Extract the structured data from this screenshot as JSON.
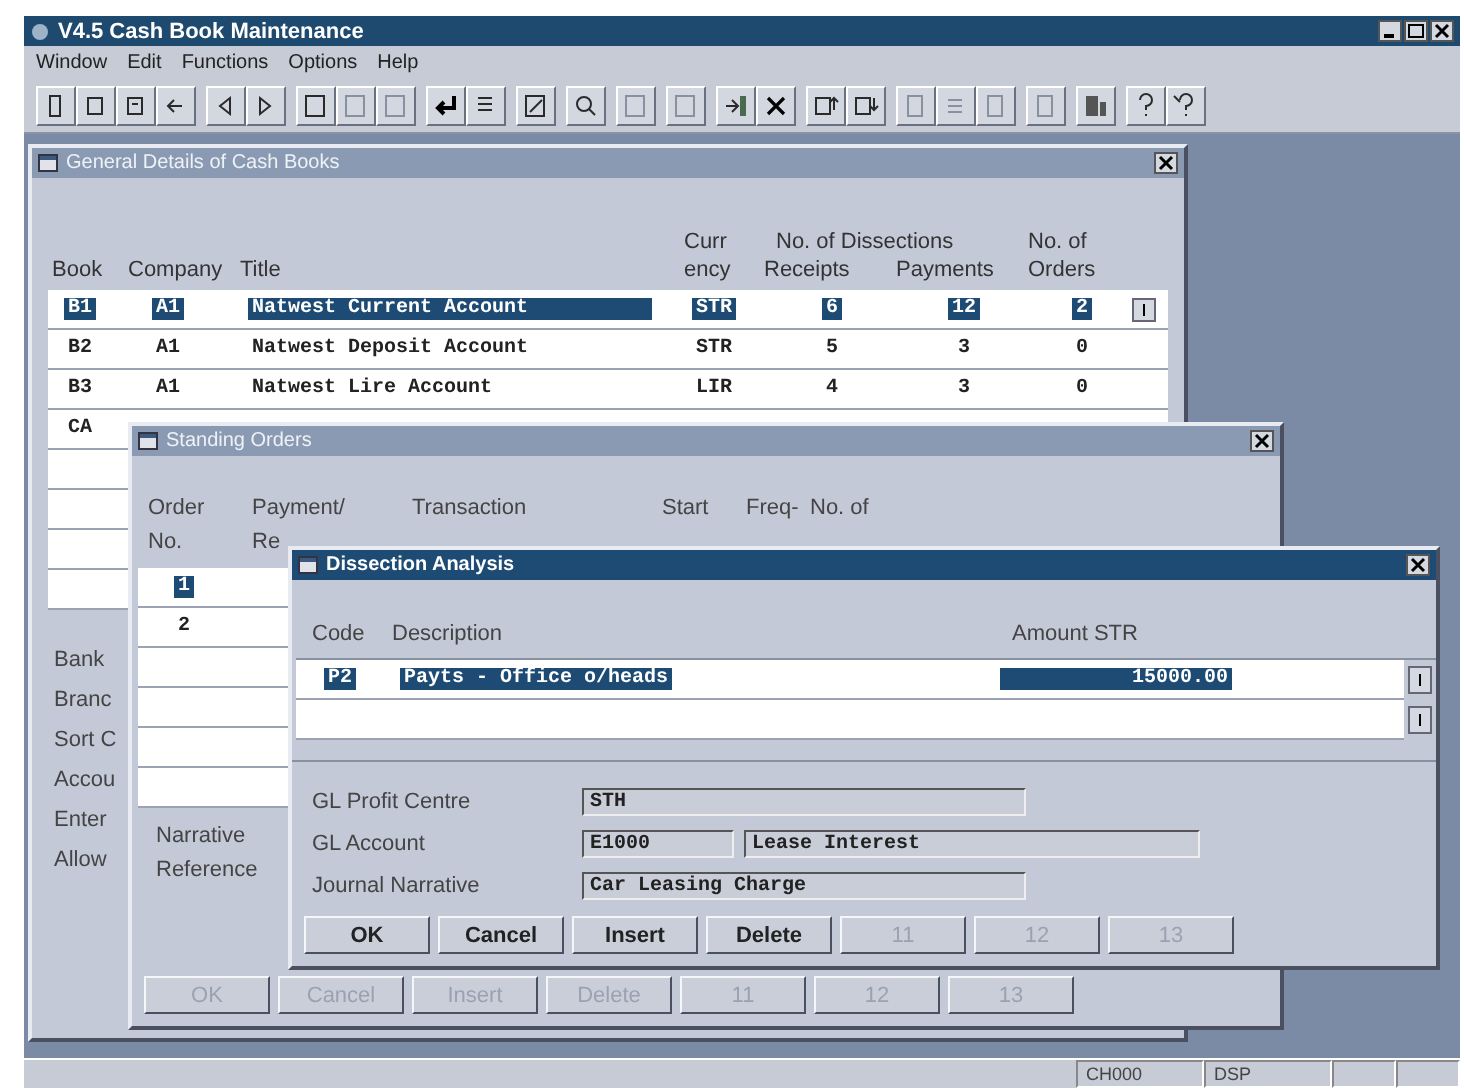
{
  "window": {
    "title": "V4.5  Cash Book Maintenance"
  },
  "menu": [
    "Window",
    "Edit",
    "Functions",
    "Options",
    "Help"
  ],
  "cash_books": {
    "title": "General Details of Cash Books",
    "active": false,
    "columns": [
      {
        "lines": [
          "Book"
        ]
      },
      {
        "lines": [
          "Company"
        ]
      },
      {
        "lines": [
          "Title"
        ]
      },
      {
        "lines": [
          "Curr",
          "ency"
        ]
      },
      {
        "lines": [
          "Receipts"
        ],
        "kind": "grouped"
      },
      {
        "lines": [
          "Payments"
        ]
      },
      {
        "lines": [
          "No. of",
          "Orders"
        ]
      }
    ],
    "group_header": "No. of Dissections",
    "rows": [
      {
        "cells": [
          "B1",
          "A1",
          "Natwest Current Account",
          "STR",
          "6",
          "12",
          "2"
        ],
        "selected": true
      },
      {
        "cells": [
          "B2",
          "A1",
          "Natwest Deposit Account",
          "STR",
          "5",
          "3",
          "0"
        ],
        "selected": false
      },
      {
        "cells": [
          "B3",
          "A1",
          "Natwest Lire Account",
          "LIR",
          "4",
          "3",
          "0"
        ],
        "selected": false
      },
      {
        "cells": [
          "CA"
        ],
        "selected": false
      }
    ],
    "labels": [
      "Bank",
      "Branc",
      "Sort C",
      "Accou",
      "Enter",
      "Allow"
    ]
  },
  "standing_orders": {
    "title": "Standing Orders",
    "active": false,
    "columns": [
      {
        "lines": [
          "Order",
          "No."
        ]
      },
      {
        "lines": [
          "Payment/",
          "Re"
        ]
      },
      {
        "lines": [
          "Transaction"
        ]
      },
      {
        "lines": [
          "Start"
        ]
      },
      {
        "lines": [
          "Freq-"
        ]
      },
      {
        "lines": [
          "No. of"
        ]
      }
    ],
    "rows": [
      {
        "order": "1",
        "selected": true
      },
      {
        "order": "2",
        "selected": false
      }
    ],
    "labels": [
      "Narrative",
      "Reference"
    ],
    "buttons": [
      {
        "label": "OK",
        "disabled": true
      },
      {
        "label": "Cancel",
        "disabled": true
      },
      {
        "label": "Insert",
        "disabled": true
      },
      {
        "label": "Delete",
        "disabled": true
      },
      {
        "label": "11",
        "disabled": true
      },
      {
        "label": "12",
        "disabled": true
      },
      {
        "label": "13",
        "disabled": true
      }
    ]
  },
  "dissection": {
    "title": "Dissection Analysis",
    "active": true,
    "columns": [
      "Code",
      "Description",
      "Amount  STR"
    ],
    "rows": [
      {
        "code": "P2",
        "description": "Payts - Office o/heads",
        "amount": "15000.00",
        "selected": true
      }
    ],
    "fields": [
      {
        "label": "GL Profit Centre",
        "values": [
          "STH"
        ]
      },
      {
        "label": "GL Account",
        "values": [
          "E1000",
          "Lease Interest"
        ]
      },
      {
        "label": "Journal Narrative",
        "values": [
          "Car Leasing Charge"
        ]
      }
    ],
    "buttons": [
      {
        "label": "OK",
        "disabled": false
      },
      {
        "label": "Cancel",
        "disabled": false
      },
      {
        "label": "Insert",
        "disabled": false
      },
      {
        "label": "Delete",
        "disabled": false
      },
      {
        "label": "11",
        "disabled": true
      },
      {
        "label": "12",
        "disabled": true
      },
      {
        "label": "13",
        "disabled": true
      }
    ]
  },
  "status_bar": [
    "CH000",
    "DSP"
  ]
}
